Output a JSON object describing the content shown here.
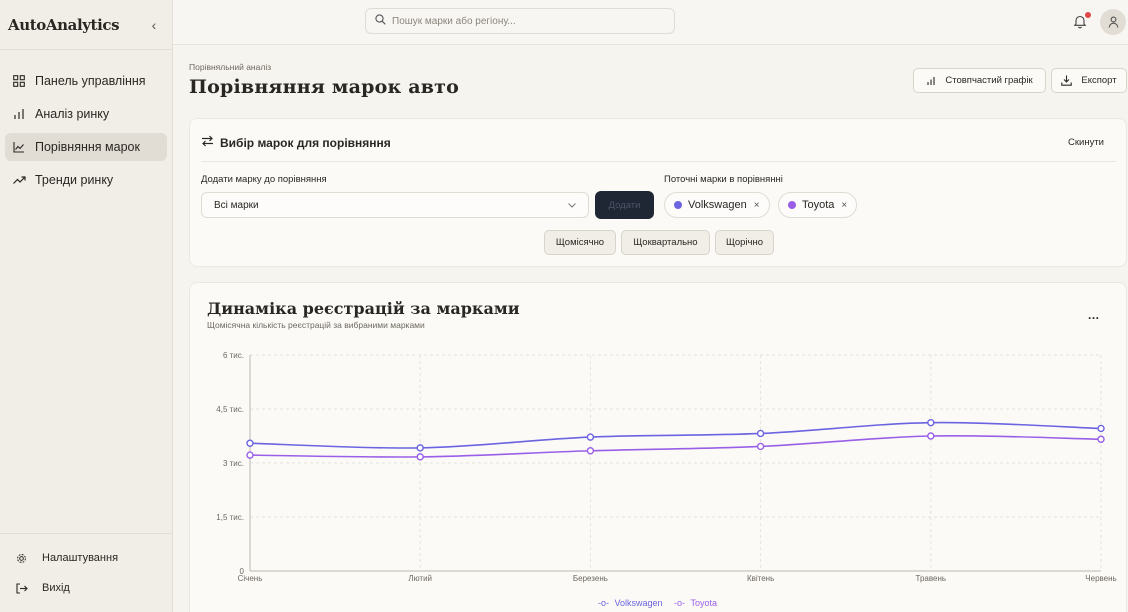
{
  "app": {
    "brand": "AutoAnalytics",
    "collapse_icon": "chevron-left-icon"
  },
  "sidebar": {
    "items": [
      {
        "label": "Панель управління",
        "icon": "dashboard-grid-icon",
        "active": false
      },
      {
        "label": "Аналіз ринку",
        "icon": "bar-chart-icon",
        "active": false
      },
      {
        "label": "Порівняння марок",
        "icon": "line-chart-icon",
        "active": true
      },
      {
        "label": "Тренди ринку",
        "icon": "trending-up-icon",
        "active": false
      }
    ],
    "bottom": [
      {
        "label": "Налаштування",
        "icon": "gear-icon"
      },
      {
        "label": "Вихід",
        "icon": "logout-icon"
      }
    ]
  },
  "topbar": {
    "search_placeholder": "Пошук марки або регіону...",
    "notification_indicator": true
  },
  "page": {
    "breadcrumb": "Порівняльний аналіз",
    "title": "Порівняння марок авто",
    "bar_chart_button": "Стовпчастий графік",
    "export_button": "Експорт"
  },
  "selection": {
    "title": "Вибір марок для порівняння",
    "reset": "Скинути",
    "add_label": "Додати марку до порівняння",
    "select_value": "Всі марки",
    "add_button": "Додати",
    "current_label": "Поточні марки в порівнянні",
    "brands": [
      {
        "name": "Volkswagen",
        "color": "#6b63e0"
      },
      {
        "name": "Toyota",
        "color": "#9a5fe8"
      }
    ],
    "periods": [
      "Щомісячно",
      "Щоквартально",
      "Щорічно"
    ]
  },
  "chart_card": {
    "title": "Динаміка реєстрацій за марками",
    "subtitle": "Щомісячна кількість реєстрацій за вибраними марками",
    "more": "..."
  },
  "chart_data": {
    "type": "line",
    "categories": [
      "Січень",
      "Лютий",
      "Березень",
      "Квітень",
      "Травень",
      "Червень"
    ],
    "y_ticks": [
      0,
      1500,
      3000,
      4500,
      6000
    ],
    "y_tick_labels": [
      "0",
      "1,5 тис.",
      "3 тис.",
      "4,5 тис.",
      "6 тис."
    ],
    "ylim": [
      0,
      6000
    ],
    "series": [
      {
        "name": "Volkswagen",
        "color": "#6b63e0",
        "values": [
          3550,
          3420,
          3720,
          3820,
          4120,
          3960
        ]
      },
      {
        "name": "Toyota",
        "color": "#9a5fe8",
        "values": [
          3220,
          3170,
          3340,
          3460,
          3750,
          3660
        ]
      }
    ],
    "grid": true,
    "legend_position": "bottom-center"
  }
}
